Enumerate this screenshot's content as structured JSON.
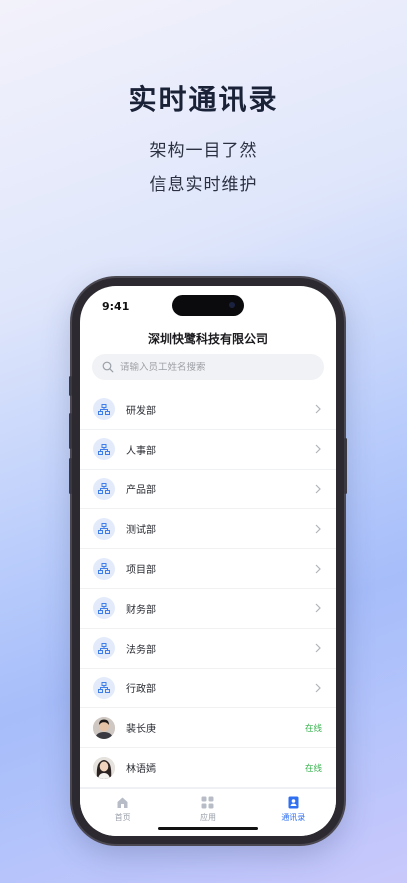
{
  "hero": {
    "title": "实时通讯录",
    "subtitle1": "架构一目了然",
    "subtitle2": "信息实时维护"
  },
  "status_bar": {
    "time": "9:41"
  },
  "header": {
    "company": "深圳快鹭科技有限公司"
  },
  "search": {
    "placeholder": "请输入员工姓名搜索",
    "icon": "search-icon"
  },
  "departments": [
    {
      "label": "研发部",
      "icon": "org-chart-icon"
    },
    {
      "label": "人事部",
      "icon": "org-chart-icon"
    },
    {
      "label": "产品部",
      "icon": "org-chart-icon"
    },
    {
      "label": "测试部",
      "icon": "org-chart-icon"
    },
    {
      "label": "项目部",
      "icon": "org-chart-icon"
    },
    {
      "label": "财务部",
      "icon": "org-chart-icon"
    },
    {
      "label": "法务部",
      "icon": "org-chart-icon"
    },
    {
      "label": "行政部",
      "icon": "org-chart-icon"
    }
  ],
  "employees": [
    {
      "name": "裴长庚",
      "status": "在线"
    },
    {
      "name": "林语嫣",
      "status": "在线"
    }
  ],
  "tabbar": {
    "tabs": [
      {
        "label": "首页",
        "icon": "home-icon",
        "active": false
      },
      {
        "label": "应用",
        "icon": "apps-grid-icon",
        "active": false
      },
      {
        "label": "通讯录",
        "icon": "contacts-icon",
        "active": true
      }
    ]
  },
  "colors": {
    "accent": "#2f6ff2",
    "online": "#38b24e",
    "dept_icon_bg": "#e3ebfb"
  }
}
